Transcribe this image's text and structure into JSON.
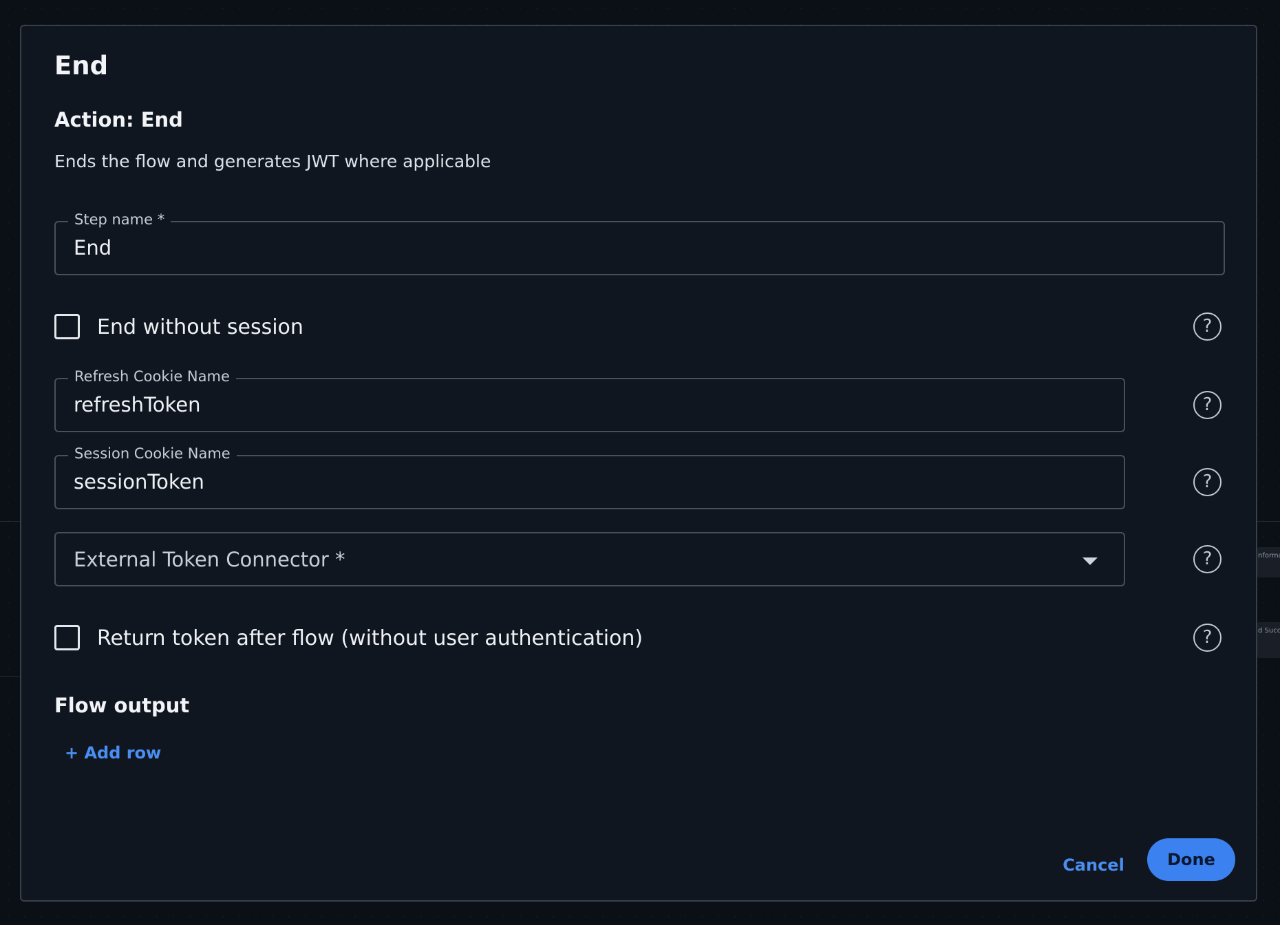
{
  "dialog": {
    "title": "End",
    "action_title": "Action: End",
    "action_description": "Ends the flow and generates JWT where applicable"
  },
  "fields": {
    "step_name": {
      "label": "Step name *",
      "value": "End"
    },
    "end_without_session": {
      "label": "End without session",
      "checked": false
    },
    "refresh_cookie_name": {
      "label": "Refresh Cookie Name",
      "value": "refreshToken"
    },
    "session_cookie_name": {
      "label": "Session Cookie Name",
      "value": "sessionToken"
    },
    "external_token_connector": {
      "placeholder": "External Token Connector *"
    },
    "return_token_after_flow": {
      "label": "Return token after flow (without user authentication)",
      "checked": false
    }
  },
  "help_icon_glyph": "?",
  "flow_output": {
    "title": "Flow output",
    "add_row_label": "+ Add row"
  },
  "footer": {
    "cancel_label": "Cancel",
    "done_label": "Done"
  },
  "background": {
    "node_1_text": "nformat",
    "node_2_text": "d Succ"
  },
  "colors": {
    "accent": "#3b82f0",
    "link": "#4a8ef1",
    "dialog_bg": "#101620",
    "border": "#4a505a"
  }
}
